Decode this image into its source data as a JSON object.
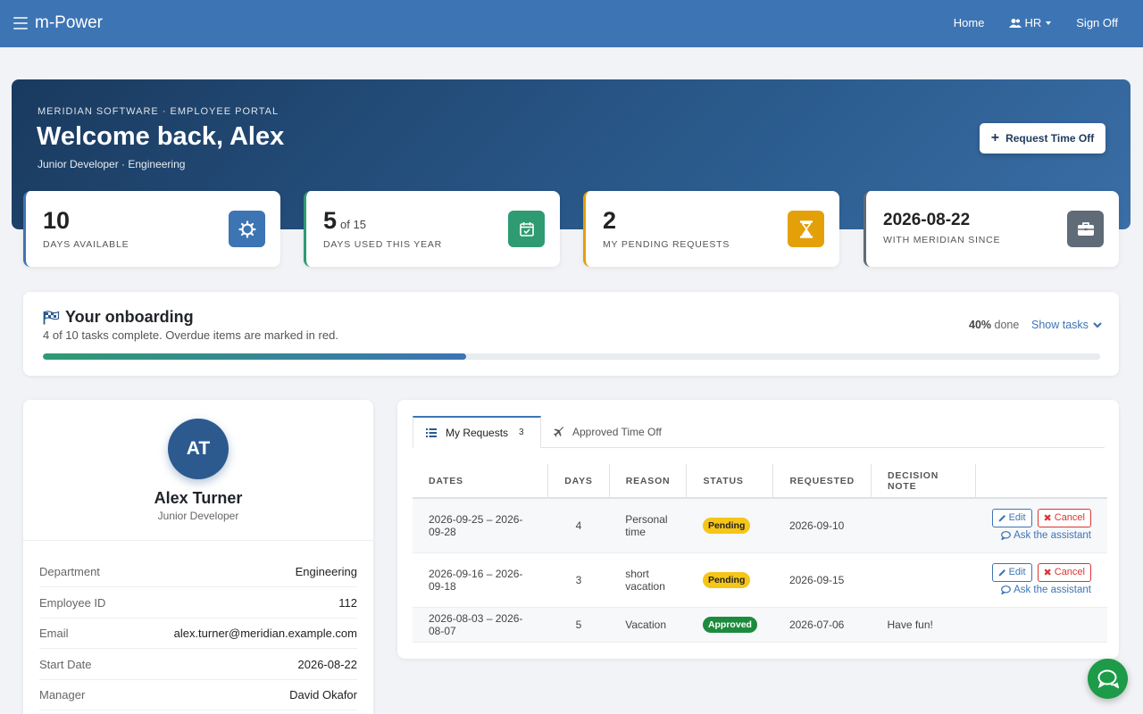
{
  "nav": {
    "brand": "m-Power",
    "home": "Home",
    "hr": "HR",
    "signoff": "Sign Off"
  },
  "hero": {
    "kicker": "MERIDIAN SOFTWARE · EMPLOYEE PORTAL",
    "title": "Welcome back, Alex",
    "subtitle": "Junior Developer · Engineering",
    "request_button": "Request Time Off"
  },
  "stats": [
    {
      "value": "10",
      "of": "",
      "label": "DAYS AVAILABLE",
      "color": "#3d74b4",
      "icon": "gear-icon"
    },
    {
      "value": "5",
      "of": "of 15",
      "label": "DAYS USED THIS YEAR",
      "color": "#2e9b72",
      "icon": "calendar-check-icon"
    },
    {
      "value": "2",
      "of": "",
      "label": "MY PENDING REQUESTS",
      "color": "#e3a008",
      "icon": "hourglass-icon"
    },
    {
      "value": "2026-08-22",
      "of": "",
      "label": "WITH MERIDIAN SINCE",
      "color": "#5f6b76",
      "icon": "briefcase-icon"
    }
  ],
  "onboarding": {
    "title": "Your onboarding",
    "subtitle": "4 of 10 tasks complete. Overdue items are marked in red.",
    "percent_label": "40%",
    "done_label": "done",
    "show_tasks": "Show tasks",
    "progress": 0.4
  },
  "profile": {
    "initials": "AT",
    "name": "Alex Turner",
    "role": "Junior Developer",
    "rows": [
      {
        "k": "Department",
        "v": "Engineering"
      },
      {
        "k": "Employee ID",
        "v": "112"
      },
      {
        "k": "Email",
        "v": "alex.turner@meridian.example.com"
      },
      {
        "k": "Start Date",
        "v": "2026-08-22"
      },
      {
        "k": "Manager",
        "v": "David Okafor"
      }
    ]
  },
  "requests": {
    "tab_active": "My Requests",
    "tab_count": "3",
    "tab_other": "Approved Time Off",
    "headers": [
      "DATES",
      "DAYS",
      "REASON",
      "STATUS",
      "REQUESTED",
      "DECISION NOTE",
      ""
    ],
    "rows": [
      {
        "dates": "2026-09-25 – 2026-09-28",
        "days": "4",
        "reason": "Personal time",
        "status": "Pending",
        "requested": "2026-09-10",
        "note": ""
      },
      {
        "dates": "2026-09-16 – 2026-09-18",
        "days": "3",
        "reason": "short vacation",
        "status": "Pending",
        "requested": "2026-09-15",
        "note": ""
      },
      {
        "dates": "2026-08-03 – 2026-08-07",
        "days": "5",
        "reason": "Vacation",
        "status": "Approved",
        "requested": "2026-07-06",
        "note": "Have fun!"
      }
    ],
    "edit_label": "Edit",
    "cancel_label": "Cancel",
    "ask_label": "Ask the assistant"
  }
}
